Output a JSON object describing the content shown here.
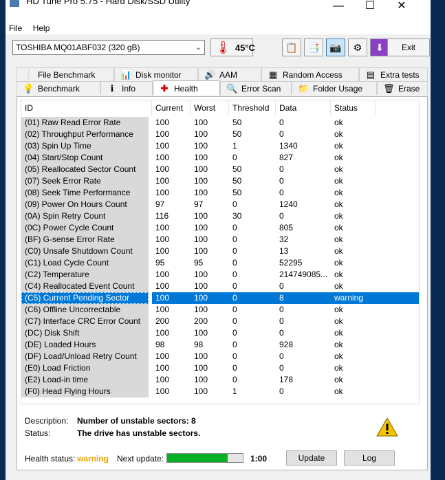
{
  "window": {
    "title": "HD Tune Pro 5.75 - Hard Disk/SSD Utility",
    "controls": {
      "minimize": "—",
      "maximize": "☐",
      "close": "✕"
    }
  },
  "menu": {
    "file": "File",
    "help": "Help"
  },
  "toolbar": {
    "drive": "TOSHIBA MQ01ABF032 (320 gB)",
    "temperature": "45°C",
    "exit_label": "Exit"
  },
  "tabs_top": [
    {
      "label": "File Benchmark",
      "icon": "file-benchmark-icon"
    },
    {
      "label": "Disk monitor",
      "icon": "disk-monitor-icon"
    },
    {
      "label": "AAM",
      "icon": "speaker-icon"
    },
    {
      "label": "Random Access",
      "icon": "random-access-icon"
    },
    {
      "label": "Extra tests",
      "icon": "extra-tests-icon"
    }
  ],
  "tabs_bottom": [
    {
      "label": "Benchmark",
      "icon": "benchmark-icon"
    },
    {
      "label": "Info",
      "icon": "info-icon"
    },
    {
      "label": "Health",
      "icon": "health-cross-icon"
    },
    {
      "label": "Error Scan",
      "icon": "magnifier-icon"
    },
    {
      "label": "Folder Usage",
      "icon": "folder-icon"
    },
    {
      "label": "Erase",
      "icon": "trash-icon"
    }
  ],
  "table": {
    "headers": {
      "id": "ID",
      "current": "Current",
      "worst": "Worst",
      "threshold": "Threshold",
      "data": "Data",
      "status": "Status"
    },
    "rows": [
      [
        "(01) Raw Read Error Rate",
        "100",
        "100",
        "50",
        "0",
        "ok"
      ],
      [
        "(02) Throughput Performance",
        "100",
        "100",
        "50",
        "0",
        "ok"
      ],
      [
        "(03) Spin Up Time",
        "100",
        "100",
        "1",
        "1340",
        "ok"
      ],
      [
        "(04) Start/Stop Count",
        "100",
        "100",
        "0",
        "827",
        "ok"
      ],
      [
        "(05) Reallocated Sector Count",
        "100",
        "100",
        "50",
        "0",
        "ok"
      ],
      [
        "(07) Seek Error Rate",
        "100",
        "100",
        "50",
        "0",
        "ok"
      ],
      [
        "(08) Seek Time Performance",
        "100",
        "100",
        "50",
        "0",
        "ok"
      ],
      [
        "(09) Power On Hours Count",
        "97",
        "97",
        "0",
        "1240",
        "ok"
      ],
      [
        "(0A) Spin Retry Count",
        "116",
        "100",
        "30",
        "0",
        "ok"
      ],
      [
        "(0C) Power Cycle Count",
        "100",
        "100",
        "0",
        "805",
        "ok"
      ],
      [
        "(BF) G-sense Error Rate",
        "100",
        "100",
        "0",
        "32",
        "ok"
      ],
      [
        "(C0) Unsafe Shutdown Count",
        "100",
        "100",
        "0",
        "13",
        "ok"
      ],
      [
        "(C1) Load Cycle Count",
        "95",
        "95",
        "0",
        "52295",
        "ok"
      ],
      [
        "(C2) Temperature",
        "100",
        "100",
        "0",
        "214749085...",
        "ok"
      ],
      [
        "(C4) Reallocated Event Count",
        "100",
        "100",
        "0",
        "0",
        "ok"
      ],
      [
        "(C5) Current Pending Sector",
        "100",
        "100",
        "0",
        "8",
        "warning"
      ],
      [
        "(C6) Offline Uncorrectable",
        "100",
        "100",
        "0",
        "0",
        "ok"
      ],
      [
        "(C7) Interface CRC Error Count",
        "200",
        "200",
        "0",
        "0",
        "ok"
      ],
      [
        "(DC) Disk Shift",
        "100",
        "100",
        "0",
        "0",
        "ok"
      ],
      [
        "(DE) Loaded Hours",
        "98",
        "98",
        "0",
        "928",
        "ok"
      ],
      [
        "(DF) Load/Unload Retry Count",
        "100",
        "100",
        "0",
        "0",
        "ok"
      ],
      [
        "(E0) Load Friction",
        "100",
        "100",
        "0",
        "0",
        "ok"
      ],
      [
        "(E2) Load-in time",
        "100",
        "100",
        "0",
        "178",
        "ok"
      ],
      [
        "(F0) Head Flying Hours",
        "100",
        "100",
        "1",
        "0",
        "ok"
      ]
    ],
    "selected_row": 15
  },
  "details": {
    "description_label": "Description:",
    "description_value": "Number of unstable sectors: 8",
    "status_label": "Status:",
    "status_value": "The drive has unstable sectors."
  },
  "footer": {
    "health_label": "Health status:",
    "health_value": "warning",
    "health_color": "#f0a500",
    "next_update_label": "Next update:",
    "progress": 0.8,
    "countdown": "1:00",
    "update_label": "Update",
    "log_label": "Log"
  }
}
